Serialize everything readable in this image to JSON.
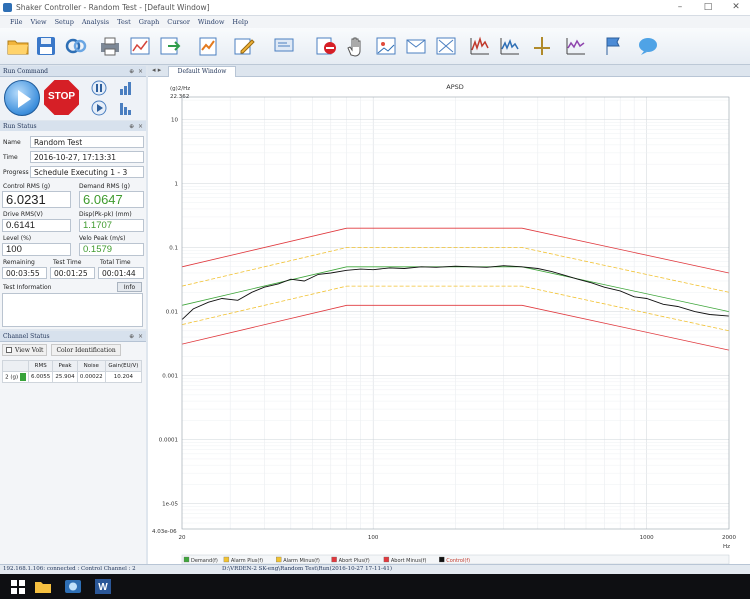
{
  "window": {
    "title": "Shaker Controller - Random Test - [Default Window]",
    "minimize": "–",
    "maximize": "□",
    "close": "✕"
  },
  "menu": [
    "File",
    "View",
    "Setup",
    "Analysis",
    "Test",
    "Graph",
    "Cursor",
    "Window",
    "Help"
  ],
  "toolbar": {
    "icons": [
      "open-folder-icon",
      "save-icon",
      "connect-icon",
      "print-icon",
      "graph-image-icon",
      "export-icon",
      "schedule-icon",
      "edit-icon",
      "monitor-icon",
      "stop-sign-icon",
      "hand-icon",
      "image-icon",
      "mail-icon",
      "fit-icon",
      "spectrum-icon",
      "spectrum-alt-icon",
      "cursor-icon",
      "average-icon",
      "flag-icon",
      "chat-icon"
    ]
  },
  "run_command": {
    "title": "Run Command",
    "pin": "⊕",
    "close": "×",
    "stop_label": "STOP"
  },
  "run_status": {
    "title": "Run Status",
    "pin": "⊕",
    "close": "×",
    "name_label": "Name",
    "name_value": "Random Test",
    "time_label": "Time",
    "time_value": "2016-10-27, 17:13:31",
    "progress_label": "Progress",
    "progress_value": "Schedule Executing 1 - 3",
    "control_rms_label": "Control RMS (g)",
    "control_rms_value": "6.0231",
    "demand_rms_label": "Demand RMS (g)",
    "demand_rms_value": "6.0647",
    "drive_rms_label": "Drive RMS(V)",
    "drive_rms_value": "0.6141",
    "disp_label": "Disp(Pk-pk) (mm)",
    "disp_value": "1.1707",
    "level_label": "Level (%)",
    "level_value": "100",
    "velo_label": "Velo Peak (m/s)",
    "velo_value": "0.1579",
    "remaining_label": "Remaining",
    "remaining_value": "00:03:55",
    "testtime_label": "Test Time",
    "testtime_value": "00:01:25",
    "totaltime_label": "Total Time",
    "totaltime_value": "00:01:44",
    "test_info_label": "Test Information",
    "info_button": "Info"
  },
  "channel_status": {
    "title": "Channel Status",
    "pin": "⊕",
    "close": "×",
    "view_volt": "View Volt",
    "color_identification": "Color Identification",
    "columns": [
      "",
      "RMS",
      "Peak",
      "Noise",
      "Gain(EU/V)"
    ],
    "rows": [
      {
        "channel": "2 (g)",
        "rms": "6.0055",
        "peak": "25.904",
        "noise": "0.00022",
        "gain": "10.204"
      }
    ]
  },
  "document": {
    "tab_label": "Default Window",
    "tab_arrows": "◂ ▸"
  },
  "statusbar": {
    "left": "192.168.1.106: connected  : Control Channel : 2",
    "right": "D:\\VRDEN-2 SK-eng\\Random Test\\Run(2016-10-27 17-11-41)"
  },
  "chart_data": {
    "type": "line",
    "title": "APSD",
    "ylabel": "(g)2/Hz",
    "xlabel": "Hz",
    "xscale": "log",
    "yscale": "log",
    "xlim": [
      20,
      2000
    ],
    "ylim": [
      4.03e-06,
      22.362
    ],
    "ylim_labels": [
      "4.03e-06",
      "22.362"
    ],
    "x_ticks": [
      "20",
      "100",
      "1000",
      "2000"
    ],
    "y_ticks": [
      "10",
      "1",
      "0.1",
      "0.01",
      "0.001",
      "0.0001",
      "1e-05"
    ],
    "grid": true,
    "legend_position": "bottom",
    "series": [
      {
        "name": "Demand(f)",
        "color": "#3fa63b",
        "x": [
          20,
          80,
          350,
          2000
        ],
        "y": [
          0.0125,
          0.05,
          0.05,
          0.01
        ]
      },
      {
        "name": "Alarm Plus(f)",
        "color": "#f1c232",
        "x": [
          20,
          80,
          350,
          2000
        ],
        "y": [
          0.025,
          0.1,
          0.1,
          0.02
        ]
      },
      {
        "name": "Alarm Minus(f)",
        "color": "#f1c232",
        "x": [
          20,
          80,
          350,
          2000
        ],
        "y": [
          0.00625,
          0.025,
          0.025,
          0.005
        ]
      },
      {
        "name": "Abort Plus(f)",
        "color": "#e0393e",
        "x": [
          20,
          80,
          350,
          2000
        ],
        "y": [
          0.05,
          0.2,
          0.2,
          0.04
        ]
      },
      {
        "name": "Abort Minus(f)",
        "color": "#e0393e",
        "x": [
          20,
          80,
          350,
          2000
        ],
        "y": [
          0.0031,
          0.0125,
          0.0125,
          0.0025
        ]
      },
      {
        "name": "Control(f)",
        "color": "#111111",
        "x": [
          20,
          22,
          25,
          28,
          32,
          36,
          40,
          45,
          50,
          56,
          63,
          70,
          80,
          90,
          100,
          115,
          130,
          150,
          170,
          200,
          230,
          260,
          300,
          350,
          400,
          450,
          500,
          560,
          630,
          700,
          800,
          900,
          1000,
          1150,
          1300,
          1500,
          1700,
          2000
        ],
        "y": [
          0.0075,
          0.011,
          0.014,
          0.016,
          0.015,
          0.02,
          0.024,
          0.027,
          0.032,
          0.03,
          0.038,
          0.04,
          0.044,
          0.046,
          0.045,
          0.048,
          0.047,
          0.05,
          0.049,
          0.051,
          0.05,
          0.049,
          0.052,
          0.05,
          0.047,
          0.042,
          0.037,
          0.032,
          0.028,
          0.024,
          0.021,
          0.017,
          0.016,
          0.013,
          0.012,
          0.01,
          0.009,
          0.0085
        ]
      }
    ]
  }
}
